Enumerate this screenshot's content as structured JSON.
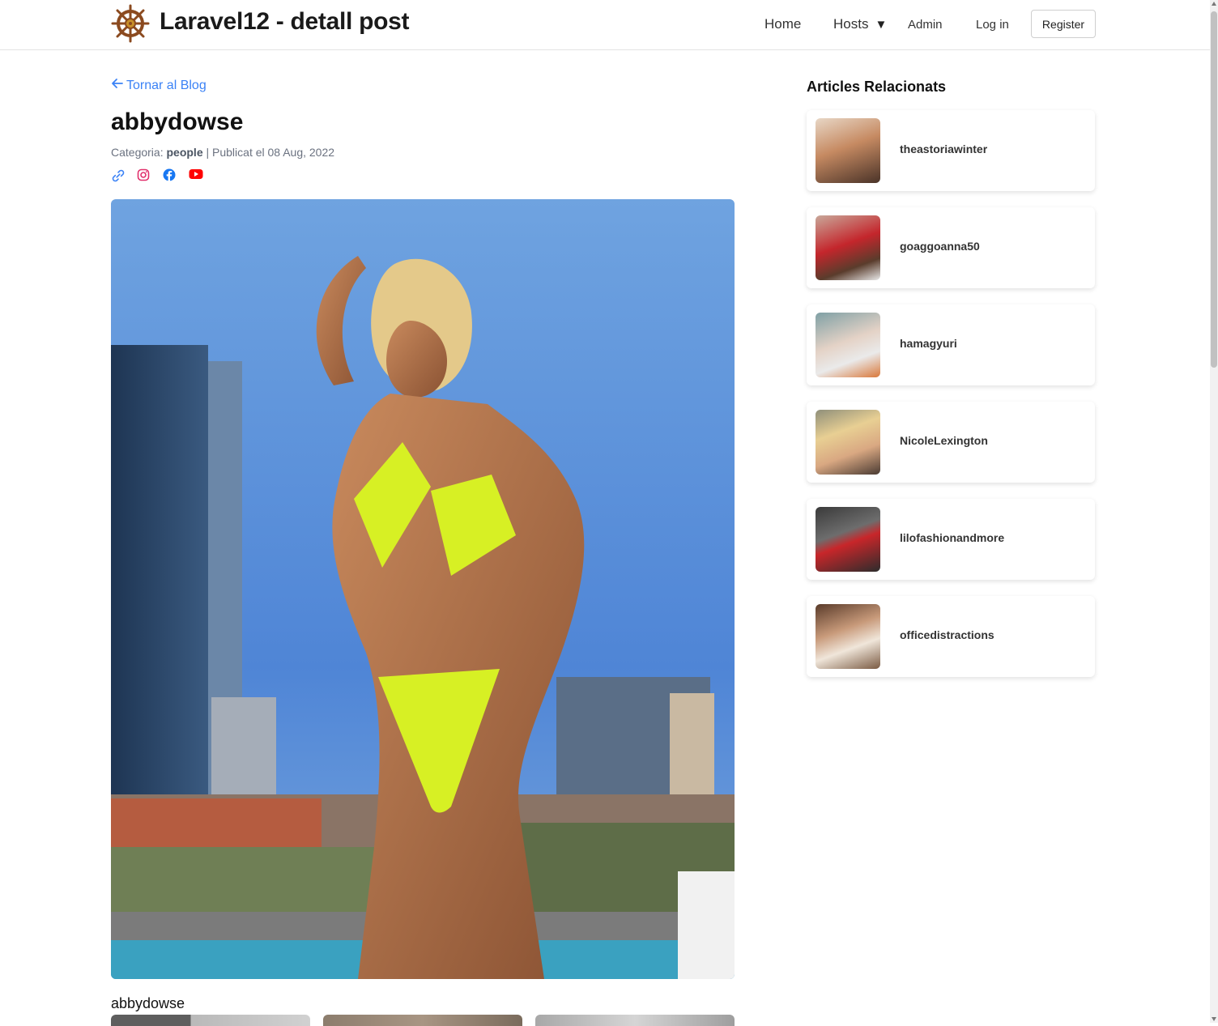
{
  "header": {
    "site_title": "Laravel12 - detall post",
    "nav": {
      "home": "Home",
      "hosts": "Hosts",
      "admin": "Admin",
      "login": "Log in",
      "register": "Register"
    }
  },
  "post": {
    "back_link": "Tornar al Blog",
    "title": "abbydowse",
    "category_label": "Categoria:",
    "category": "people",
    "published": "| Publicat el 08 Aug, 2022",
    "caption": "abbydowse",
    "social_icons": [
      "link-icon",
      "instagram-icon",
      "facebook-icon",
      "youtube-icon"
    ]
  },
  "sidebar": {
    "title": "Articles Relacionats",
    "items": [
      {
        "name": "theastoriawinter"
      },
      {
        "name": "goaggoanna50"
      },
      {
        "name": "hamagyuri"
      },
      {
        "name": "NicoleLexington"
      },
      {
        "name": "lilofashionandmore"
      },
      {
        "name": "officedistractions"
      }
    ]
  },
  "colors": {
    "link_blue": "#3b82f6",
    "instagram": "#e1306c",
    "facebook": "#1877f2",
    "youtube": "#ff0000"
  }
}
